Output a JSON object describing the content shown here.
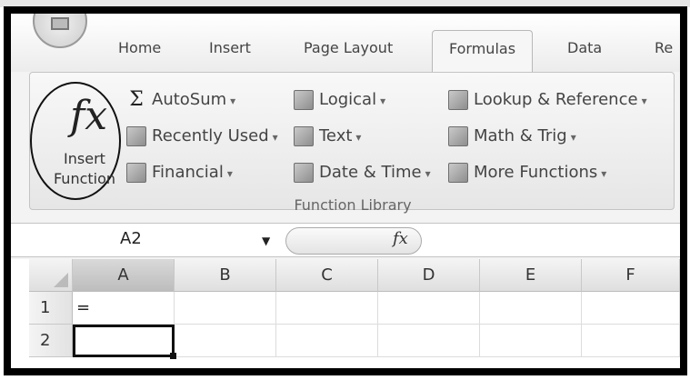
{
  "tabs": [
    "Home",
    "Insert",
    "Page Layout",
    "Formulas",
    "Data",
    "Re"
  ],
  "active_tab": "Formulas",
  "ribbon": {
    "insert_function": {
      "icon_text": "fx",
      "label_line1": "Insert",
      "label_line2": "Function"
    },
    "col1": [
      {
        "label": "AutoSum",
        "icon": "sigma-icon"
      },
      {
        "label": "Recently Used",
        "icon": "book-icon"
      },
      {
        "label": "Financial",
        "icon": "book-icon"
      }
    ],
    "col2": [
      {
        "label": "Logical",
        "icon": "book-icon"
      },
      {
        "label": "Text",
        "icon": "book-icon"
      },
      {
        "label": "Date & Time",
        "icon": "book-icon"
      }
    ],
    "col3": [
      {
        "label": "Lookup & Reference",
        "icon": "book-icon"
      },
      {
        "label": "Math & Trig",
        "icon": "book-icon"
      },
      {
        "label": "More Functions",
        "icon": "book-icon"
      }
    ],
    "group_label": "Function Library"
  },
  "formula_bar": {
    "name_box": "A2",
    "fx_label": "fx",
    "formula": ""
  },
  "grid": {
    "columns": [
      "A",
      "B",
      "C",
      "D",
      "E",
      "F"
    ],
    "rows": [
      "1",
      "2"
    ],
    "cells": {
      "A1": "=",
      "A2": ""
    },
    "active_cell": "A2"
  }
}
